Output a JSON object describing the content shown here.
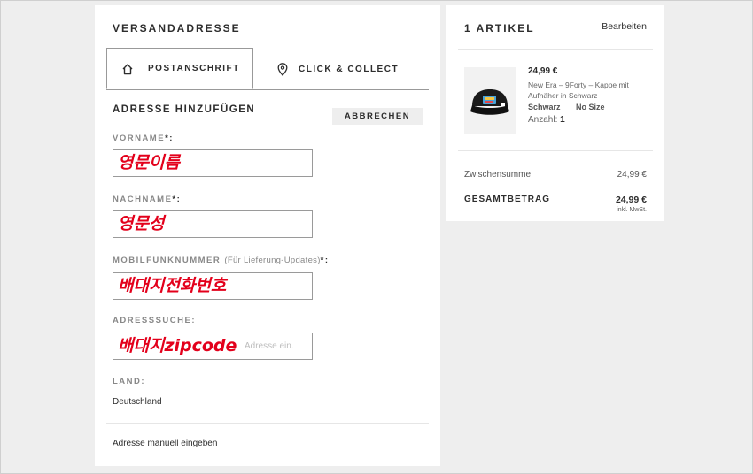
{
  "shipping": {
    "title": "VERSANDADRESSE",
    "tabs": [
      {
        "label": "POSTANSCHRIFT",
        "icon": "home-icon",
        "active": true
      },
      {
        "label": "CLICK & COLLECT",
        "icon": "location-pin-icon",
        "active": false
      }
    ],
    "section_title": "ADRESSE HINZUFÜGEN",
    "cancel_label": "ABBRECHEN",
    "fields": {
      "first_name": {
        "label": "VORNAME",
        "required_mark": "*:",
        "value": "영문이름"
      },
      "last_name": {
        "label": "NACHNAME",
        "required_mark": "*:",
        "value": "영문성"
      },
      "mobile": {
        "label": "MOBILFUNKNUMMER",
        "hint": "(Für Lieferung-Updates)",
        "required_mark": "*:",
        "value": "배대지전화번호"
      },
      "address_search": {
        "label": "ADRESSSUCHE:",
        "value": "배대지zipcode",
        "placeholder": "Adresse ein."
      }
    },
    "country": {
      "label": "LAND:",
      "value": "Deutschland"
    },
    "manual_link": "Adresse manuell eingeben"
  },
  "cart": {
    "title": "1 ARTIKEL",
    "edit_label": "Bearbeiten",
    "item": {
      "price": "24,99 €",
      "name": "New Era – 9Forty – Kappe mit Aufnäher in Schwarz",
      "color": "Schwarz",
      "size": "No Size",
      "qty_label": "Anzahl:",
      "qty": "1"
    },
    "subtotal_label": "Zwischensumme",
    "subtotal_value": "24,99 €",
    "total_label": "GESAMTBETRAG",
    "total_value": "24,99 €",
    "tax_note": "inkl. MwSt."
  },
  "colors": {
    "overlay_text": "#e3001b",
    "panel_bg": "#ffffff",
    "page_bg": "#eeeeee"
  }
}
